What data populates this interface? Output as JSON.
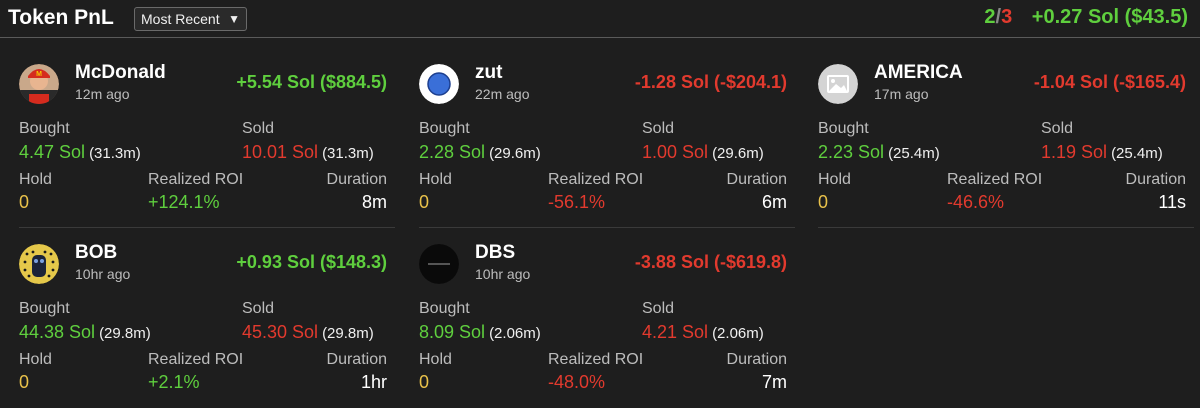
{
  "header": {
    "title": "Token PnL",
    "sort": {
      "selected": "Most Recent"
    },
    "summary": {
      "wins": "2",
      "separator": "/",
      "total": "3",
      "pnl": "+0.27 Sol ($43.5)"
    }
  },
  "labels": {
    "bought": "Bought",
    "sold": "Sold",
    "hold": "Hold",
    "roi": "Realized ROI",
    "duration": "Duration"
  },
  "tokens": [
    {
      "name": "McDonald",
      "ago": "12m ago",
      "pnl": "+5.54 Sol ($884.5)",
      "pnl_sign": "positive",
      "bought": "4.47 Sol",
      "bought_sub": "(31.3m)",
      "sold": "10.01 Sol",
      "sold_sub": "(31.3m)",
      "hold": "0",
      "roi": "+124.1%",
      "duration": "8m",
      "avatar_icon": "mcdonald-avatar-icon"
    },
    {
      "name": "zut",
      "ago": "22m ago",
      "pnl": "-1.28 Sol (-$204.1)",
      "pnl_sign": "negative",
      "bought": "2.28 Sol",
      "bought_sub": "(29.6m)",
      "sold": "1.00 Sol",
      "sold_sub": "(29.6m)",
      "hold": "0",
      "roi": "-56.1%",
      "duration": "6m",
      "avatar_icon": "blue-circle-avatar-icon"
    },
    {
      "name": "AMERICA",
      "ago": "17m ago",
      "pnl": "-1.04 Sol (-$165.4)",
      "pnl_sign": "negative",
      "bought": "2.23 Sol",
      "bought_sub": "(25.4m)",
      "sold": "1.19 Sol",
      "sold_sub": "(25.4m)",
      "hold": "0",
      "roi": "-46.6%",
      "duration": "11s",
      "avatar_icon": "image-placeholder-icon"
    },
    {
      "name": "BOB",
      "ago": "10hr ago",
      "pnl": "+0.93 Sol ($148.3)",
      "pnl_sign": "positive",
      "bought": "44.38 Sol",
      "bought_sub": "(29.8m)",
      "sold": "45.30 Sol",
      "sold_sub": "(29.8m)",
      "hold": "0",
      "roi": "+2.1%",
      "duration": "1hr",
      "avatar_icon": "bob-avatar-icon"
    },
    {
      "name": "DBS",
      "ago": "10hr ago",
      "pnl": "-3.88 Sol (-$619.8)",
      "pnl_sign": "negative",
      "bought": "8.09 Sol",
      "bought_sub": "(2.06m)",
      "sold": "4.21 Sol",
      "sold_sub": "(2.06m)",
      "hold": "0",
      "roi": "-48.0%",
      "duration": "7m",
      "avatar_icon": "dark-logo-avatar-icon"
    }
  ],
  "colors": {
    "positive": "#5fcf3e",
    "negative": "#e23a2e",
    "hold": "#e8c14a",
    "background": "#1e1e1e"
  }
}
